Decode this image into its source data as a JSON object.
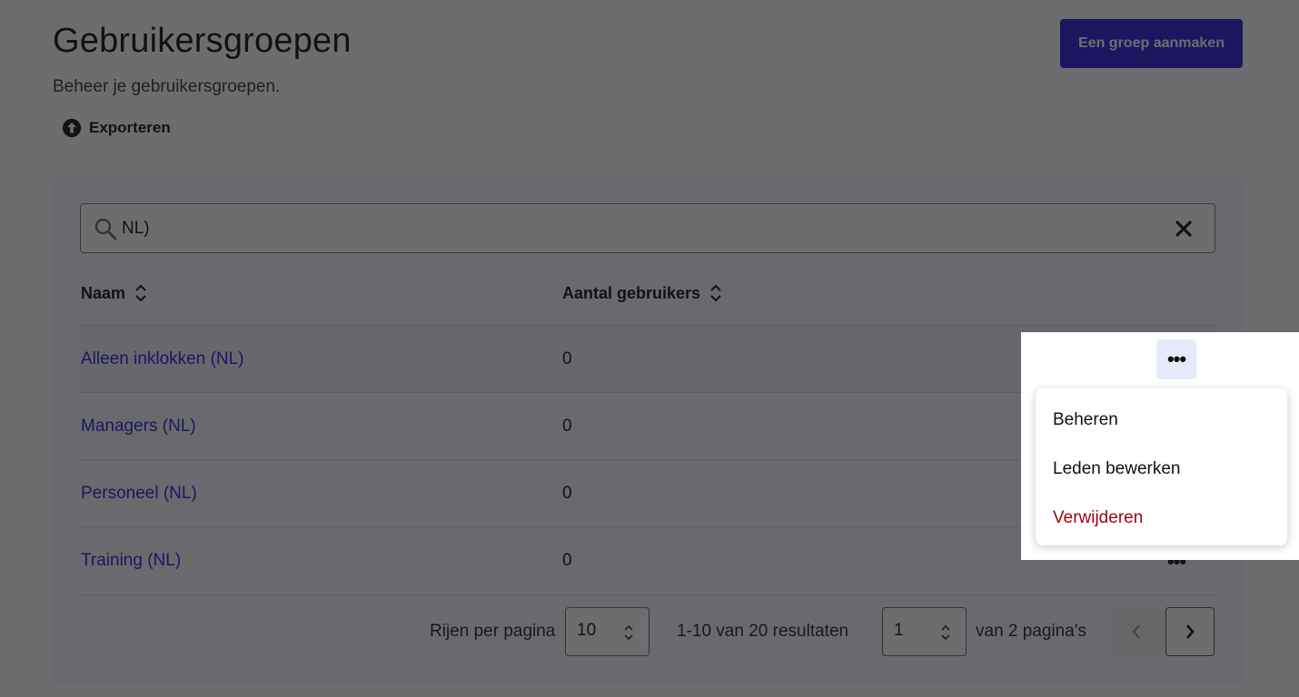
{
  "header": {
    "title": "Gebruikersgroepen",
    "subtitle": "Beheer je gebruikersgroepen.",
    "export_label": "Exporteren",
    "create_button": "Een groep aanmaken"
  },
  "search": {
    "value": "NL)"
  },
  "table": {
    "columns": [
      "Naam",
      "Aantal gebruikers"
    ],
    "rows": [
      {
        "name": "Alleen inklokken (NL)",
        "count": "0"
      },
      {
        "name": "Managers (NL)",
        "count": "0"
      },
      {
        "name": "Personeel (NL)",
        "count": "0"
      },
      {
        "name": "Training (NL)",
        "count": "0"
      }
    ],
    "more_label": "•••"
  },
  "pagination": {
    "rows_per_page_label": "Rijen per pagina",
    "rows_per_page_value": "10",
    "results_text": "1-10 van 20 resultaten",
    "page_value": "1",
    "pages_text": "van 2 pagina's"
  },
  "context_menu": {
    "items": [
      "Beheren",
      "Leden bewerken",
      "Verwijderen"
    ]
  },
  "colors": {
    "accent": "#2a1ad6",
    "danger": "#9b0012",
    "overlay": "#141418"
  },
  "icons": {
    "export": "upload-arrow-circle-icon",
    "search": "magnifier-icon",
    "clear": "close-x-icon",
    "sort": "sort-updown-icon",
    "select": "chevron-updown-icon",
    "prev": "chevron-left-icon",
    "next": "chevron-right-icon"
  }
}
